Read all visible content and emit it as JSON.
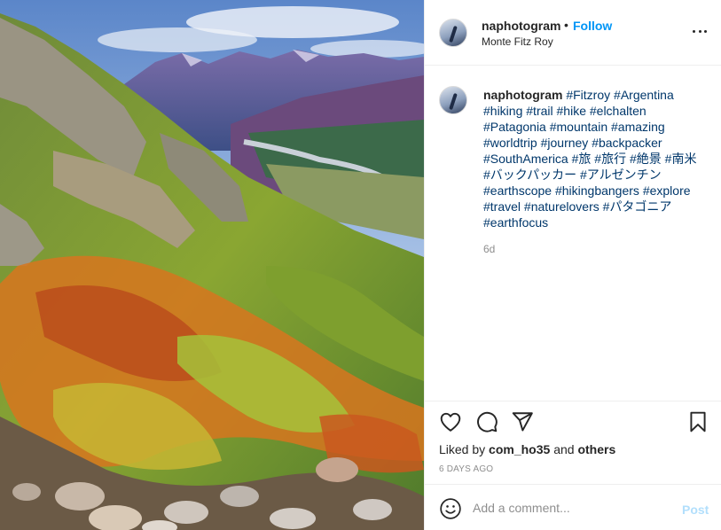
{
  "header": {
    "username": "naphotogram",
    "separator": "•",
    "follow_label": "Follow",
    "location": "Monte Fitz Roy"
  },
  "caption": {
    "username": "naphotogram",
    "tags": [
      "#Fitzroy",
      "#Argentina",
      "#hiking",
      "#trail",
      "#hike",
      "#elchalten",
      "#Patagonia",
      "#mountain",
      "#amazing",
      "#worldtrip",
      "#journey",
      "#backpacker",
      "#SouthAmerica",
      "#旅",
      "#旅行",
      "#絶景",
      "#南米",
      "#バックパッカー",
      "#アルゼンチン",
      "#earthscope",
      "#hikingbangers",
      "#explore",
      "#travel",
      "#naturelovers",
      "#パタゴニア",
      "#earthfocus"
    ],
    "time": "6d"
  },
  "likes": {
    "prefix": "Liked by",
    "user": "com_ho35",
    "joiner": "and",
    "others": "others"
  },
  "timestamp": "6 DAYS AGO",
  "comment": {
    "placeholder": "Add a comment...",
    "post_label": "Post"
  },
  "icons": {
    "like": "heart-icon",
    "comment": "comment-icon",
    "share": "paper-plane-icon",
    "save": "bookmark-icon",
    "emoji": "smiley-icon",
    "more": "more-dots-icon"
  },
  "colors": {
    "link_blue": "#0095f6",
    "hashtag": "#00376b",
    "muted": "#8e8e8e",
    "post_disabled": "#b2dffc"
  }
}
